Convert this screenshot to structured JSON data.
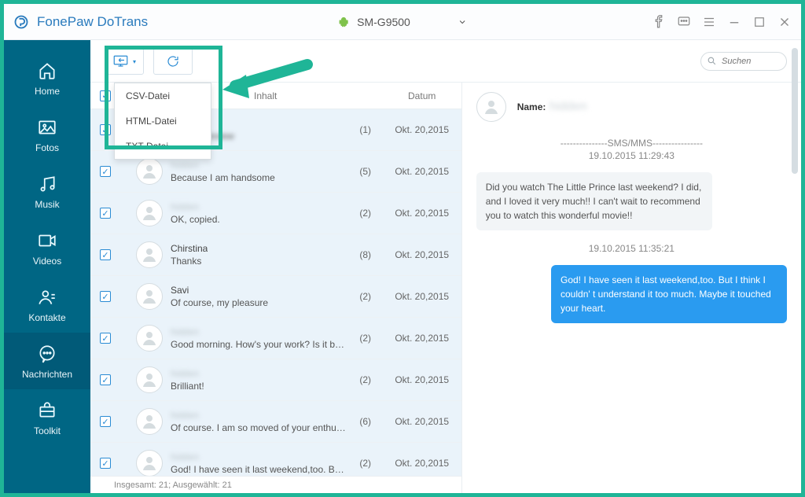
{
  "app": {
    "name": "FonePaw DoTrans"
  },
  "device": {
    "model": "SM-G9500"
  },
  "search": {
    "placeholder": "Suchen"
  },
  "sidebar": {
    "items": [
      {
        "label": "Home"
      },
      {
        "label": "Fotos"
      },
      {
        "label": "Musik"
      },
      {
        "label": "Videos"
      },
      {
        "label": "Kontakte"
      },
      {
        "label": "Nachrichten"
      },
      {
        "label": "Toolkit"
      }
    ]
  },
  "exportMenu": {
    "items": [
      "CSV-Datei",
      "HTML-Datei",
      "TXT-Datei"
    ]
  },
  "columns": {
    "content": "Inhalt",
    "date": "Datum"
  },
  "rows": [
    {
      "name": "",
      "preview": "",
      "count": "(1)",
      "date": "Okt. 20,2015",
      "blurName": true,
      "blurPreview": true
    },
    {
      "name": "",
      "preview": "Because I am handsome",
      "count": "(5)",
      "date": "Okt. 20,2015",
      "blurName": true
    },
    {
      "name": "",
      "preview": "OK, copied.",
      "count": "(2)",
      "date": "Okt. 20,2015",
      "blurName": true
    },
    {
      "name": "Chirstina",
      "preview": "Thanks",
      "count": "(8)",
      "date": "Okt. 20,2015"
    },
    {
      "name": "Savi",
      "preview": "Of course, my pleasure",
      "count": "(2)",
      "date": "Okt. 20,2015"
    },
    {
      "name": "",
      "preview": "Good morning. How's your work? Is it busy?",
      "count": "(2)",
      "date": "Okt. 20,2015",
      "blurName": true
    },
    {
      "name": "",
      "preview": "Brilliant!",
      "count": "(2)",
      "date": "Okt. 20,2015",
      "blurName": true
    },
    {
      "name": "",
      "preview": "Of course. I am so moved of your enthusiasm",
      "count": "(6)",
      "date": "Okt. 20,2015",
      "blurName": true
    },
    {
      "name": "",
      "preview": "God! I have seen it last weekend,too. But I think I ...",
      "count": "(2)",
      "date": "Okt. 20,2015",
      "blurName": true
    }
  ],
  "status": {
    "text": "Insgesamt: 21; Ausgewählt: 21"
  },
  "detail": {
    "nameLabel": "Name:",
    "nameValue": "hidden",
    "separator": "---------------SMS/MMS----------------",
    "ts1": "19.10.2015 11:29:43",
    "inMsg": "Did you watch The Little Prince last weekend? I did, and I loved it very much!! I can't wait to recommend you to watch this wonderful movie!!",
    "ts2": "19.10.2015 11:35:21",
    "outMsg": "God! I have seen it last weekend,too. But I think I couldn' t understand it too much. Maybe it touched your heart."
  }
}
